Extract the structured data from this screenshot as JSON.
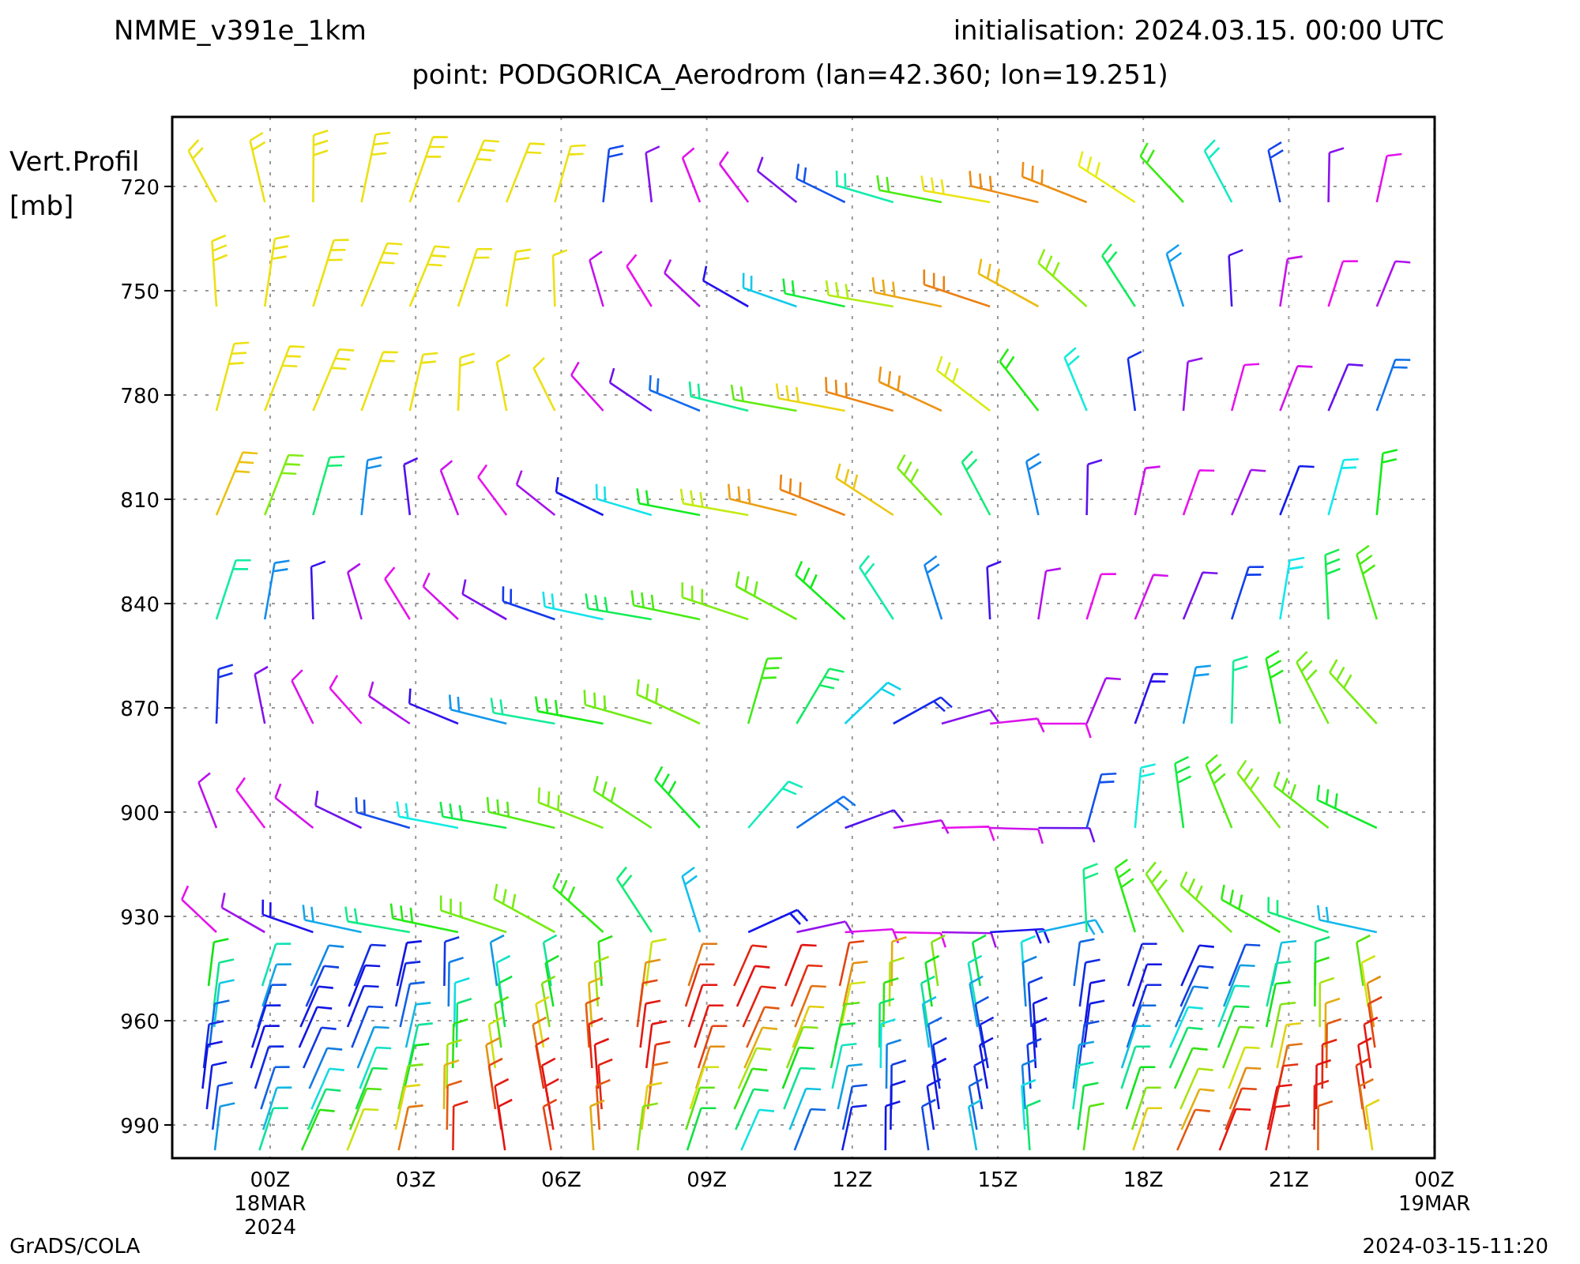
{
  "header": {
    "model": "NMME_v391e_1km",
    "initialisation": "initialisation: 2024.03.15. 00:00 UTC",
    "point": "point: PODGORICA_Aerodrom (lan=42.360; lon=19.251)"
  },
  "plot": {
    "ylabel": [
      "Vert.Profil",
      "[mb]"
    ],
    "yticks": [
      "720",
      "750",
      "780",
      "810",
      "840",
      "870",
      "900",
      "930",
      "960",
      "990"
    ],
    "xticks": [
      {
        "lines": [
          "00Z",
          "18MAR",
          "2024"
        ]
      },
      {
        "lines": [
          "03Z"
        ]
      },
      {
        "lines": [
          "06Z"
        ]
      },
      {
        "lines": [
          "09Z"
        ]
      },
      {
        "lines": [
          "12Z"
        ]
      },
      {
        "lines": [
          "15Z"
        ]
      },
      {
        "lines": [
          "18Z"
        ]
      },
      {
        "lines": [
          "21Z"
        ]
      },
      {
        "lines": [
          "00Z",
          "19MAR"
        ]
      }
    ]
  },
  "footer": {
    "left": "GrADS/COLA",
    "right": "2024-03-15-11:20"
  }
}
